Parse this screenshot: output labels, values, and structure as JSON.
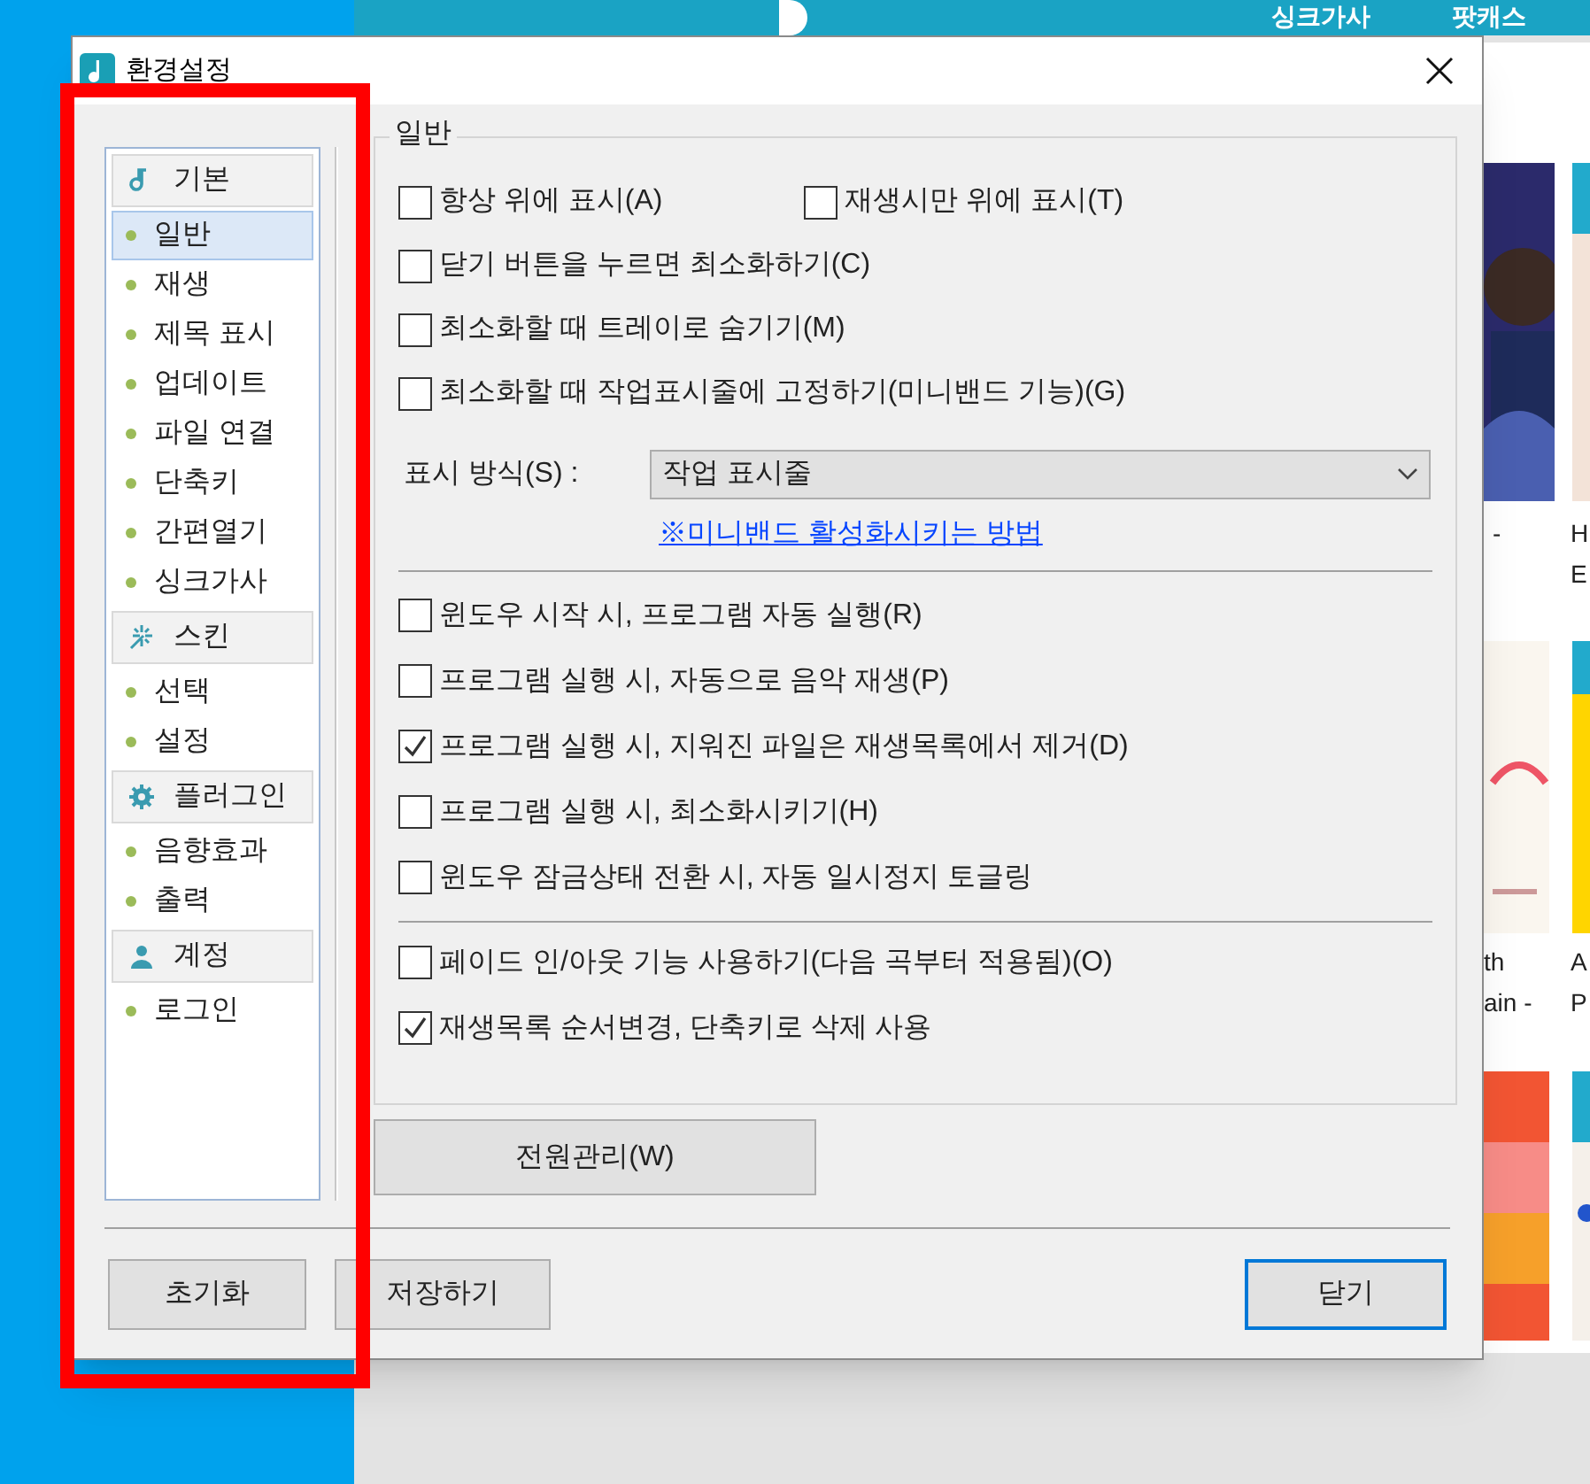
{
  "background_app": {
    "tabs": [
      "싱크가사",
      "팟캐스"
    ],
    "captions": [
      "-",
      "H\nE",
      "th\nain -",
      "A\nP"
    ]
  },
  "window": {
    "title": "환경설정"
  },
  "sidebar": {
    "groups": [
      {
        "label": "기본",
        "items": [
          {
            "label": "일반",
            "selected": true
          },
          {
            "label": "재생",
            "selected": false
          },
          {
            "label": "제목 표시",
            "selected": false
          },
          {
            "label": "업데이트",
            "selected": false
          },
          {
            "label": "파일 연결",
            "selected": false
          },
          {
            "label": "단축키",
            "selected": false
          },
          {
            "label": "간편열기",
            "selected": false
          },
          {
            "label": "싱크가사",
            "selected": false
          }
        ]
      },
      {
        "label": "스킨",
        "items": [
          {
            "label": "선택",
            "selected": false
          },
          {
            "label": "설정",
            "selected": false
          }
        ]
      },
      {
        "label": "플러그인",
        "items": [
          {
            "label": "음향효과",
            "selected": false
          },
          {
            "label": "출력",
            "selected": false
          }
        ]
      },
      {
        "label": "계정",
        "items": [
          {
            "label": "로그인",
            "selected": false
          }
        ]
      }
    ]
  },
  "general": {
    "title": "일반",
    "section_1": [
      [
        {
          "label": "항상 위에 표시(A)",
          "checked": false
        },
        {
          "label": "재생시만 위에 표시(T)",
          "checked": false
        }
      ],
      [
        {
          "label": "닫기 버튼을 누르면 최소화하기(C)",
          "checked": false
        }
      ],
      [
        {
          "label": "최소화할 때 트레이로 숨기기(M)",
          "checked": false
        }
      ],
      [
        {
          "label": "최소화할 때 작업표시줄에 고정하기(미니밴드 기능)(G)",
          "checked": false
        }
      ]
    ],
    "display_mode": {
      "label": "표시 방식(S) :",
      "value": "작업 표시줄",
      "link": "※미니밴드 활성화시키는 방법"
    },
    "section_2": [
      {
        "label": "윈도우 시작 시, 프로그램 자동 실행(R)",
        "checked": false
      },
      {
        "label": "프로그램 실행 시, 자동으로 음악 재생(P)",
        "checked": false
      },
      {
        "label": "프로그램 실행 시, 지워진 파일은 재생목록에서 제거(D)",
        "checked": true
      },
      {
        "label": "프로그램 실행 시, 최소화시키기(H)",
        "checked": false
      },
      {
        "label": "윈도우 잠금상태 전환 시, 자동 일시정지 토글링",
        "checked": false
      }
    ],
    "section_3": [
      {
        "label": "페이드 인/아웃 기능 사용하기(다음 곡부터 적용됨)(O)",
        "checked": false
      },
      {
        "label": "재생목록 순서변경, 단축키로 삭제 사용",
        "checked": true
      }
    ]
  },
  "power_button": "전원관리(W)",
  "buttons": [
    {
      "label": "초기화",
      "default": false
    },
    {
      "label": "저장하기",
      "default": false
    },
    {
      "label": "닫기",
      "default": true
    }
  ]
}
